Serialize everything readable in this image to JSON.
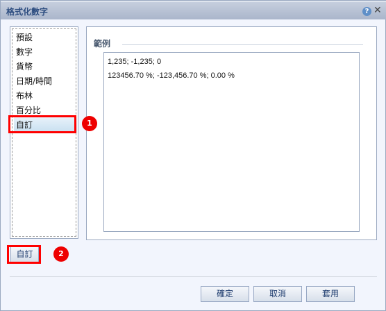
{
  "dialog": {
    "title": "格式化數字",
    "help_icon": "help-icon",
    "close_icon": "close-icon"
  },
  "categories": [
    "預設",
    "數字",
    "貨幣",
    "日期/時間",
    "布林",
    "百分比",
    "自訂"
  ],
  "selected_category": "自訂",
  "sample": {
    "legend": "範例",
    "lines": [
      "1,235; -1,235; 0",
      "123456.70 %; -123,456.70 %; 0.00 %"
    ]
  },
  "custom_button": "自訂",
  "annotations": {
    "badge1": "1",
    "badge2": "2",
    "highlight_color": "#ff0000"
  },
  "footer": {
    "ok": "確定",
    "cancel": "取消",
    "apply": "套用"
  }
}
